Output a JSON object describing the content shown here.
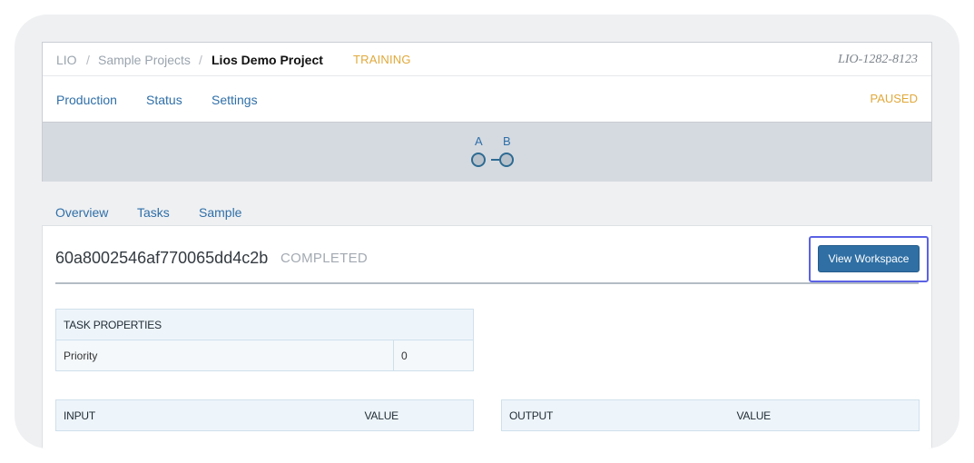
{
  "breadcrumb": {
    "items": [
      "LIO",
      "Sample Projects"
    ],
    "separator": "/",
    "current": "Lios Demo Project"
  },
  "project": {
    "stage_badge": "TRAINING",
    "id": "LIO-1282-8123",
    "state_badge": "PAUSED"
  },
  "nav": {
    "production": "Production",
    "status": "Status",
    "settings": "Settings"
  },
  "stepper": {
    "steps": [
      "A",
      "B"
    ]
  },
  "tabs": {
    "overview": "Overview",
    "tasks": "Tasks",
    "sample": "Sample"
  },
  "task": {
    "id": "60a8002546af770065dd4c2b",
    "status": "COMPLETED",
    "view_workspace_label": "View Workspace"
  },
  "task_properties": {
    "header": "TASK PROPERTIES",
    "rows": [
      {
        "label": "Priority",
        "value": "0"
      }
    ]
  },
  "input_table": {
    "col1": "INPUT",
    "col2": "VALUE"
  },
  "output_table": {
    "col1": "OUTPUT",
    "col2": "VALUE"
  },
  "colors": {
    "accent": "#2f6fa8",
    "badge": "#e0a93b",
    "highlight": "#5b62e4"
  }
}
